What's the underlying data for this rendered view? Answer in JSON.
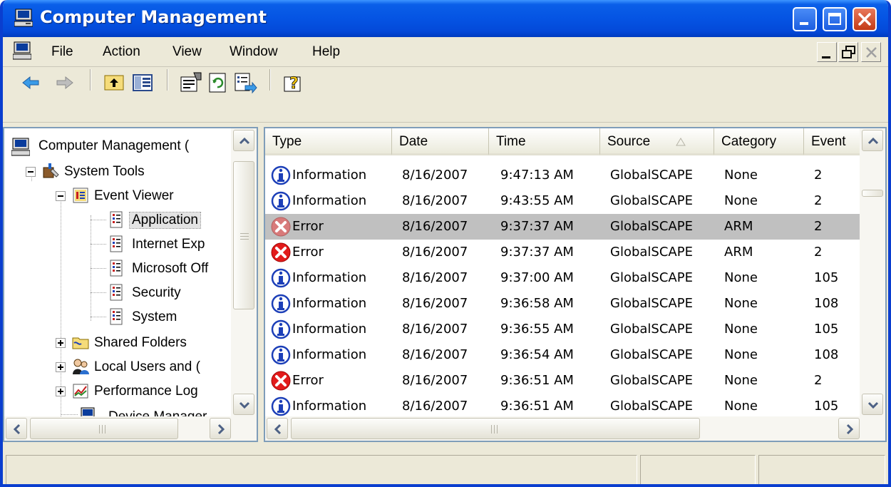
{
  "window": {
    "title": "Computer Management"
  },
  "menu": [
    {
      "label": "File"
    },
    {
      "label": "Action"
    },
    {
      "label": "View"
    },
    {
      "label": "Window"
    },
    {
      "label": "Help"
    }
  ],
  "toolbar": [
    {
      "icon": "back-arrow-icon"
    },
    {
      "icon": "forward-arrow-icon"
    },
    {
      "icon": "up-folder-icon"
    },
    {
      "icon": "show-hide-tree-icon"
    },
    {
      "icon": "properties-icon"
    },
    {
      "icon": "refresh-icon"
    },
    {
      "icon": "export-list-icon"
    },
    {
      "icon": "help-icon"
    }
  ],
  "tree": {
    "root": "Computer Management (",
    "items": [
      {
        "label": "System Tools"
      },
      {
        "label": "Event Viewer"
      },
      {
        "label": "Application"
      },
      {
        "label": "Internet Exp"
      },
      {
        "label": "Microsoft Off"
      },
      {
        "label": "Security"
      },
      {
        "label": "System"
      },
      {
        "label": "Shared Folders"
      },
      {
        "label": "Local Users and ("
      },
      {
        "label": "Performance Log"
      },
      {
        "label": "Device Manager"
      }
    ]
  },
  "list": {
    "columns": [
      "Type",
      "Date",
      "Time",
      "Source",
      "Category",
      "Event"
    ],
    "sort_column": "Source",
    "rows": [
      {
        "type": "Information",
        "date": "8/16/2007",
        "time": "9:47:13 AM",
        "source": "GlobalSCAPE",
        "category": "None",
        "event": "2"
      },
      {
        "type": "Information",
        "date": "8/16/2007",
        "time": "9:43:55 AM",
        "source": "GlobalSCAPE",
        "category": "None",
        "event": "2"
      },
      {
        "type": "Error",
        "date": "8/16/2007",
        "time": "9:37:37 AM",
        "source": "GlobalSCAPE",
        "category": "ARM",
        "event": "2",
        "selected": true
      },
      {
        "type": "Error",
        "date": "8/16/2007",
        "time": "9:37:37 AM",
        "source": "GlobalSCAPE",
        "category": "ARM",
        "event": "2"
      },
      {
        "type": "Information",
        "date": "8/16/2007",
        "time": "9:37:00 AM",
        "source": "GlobalSCAPE",
        "category": "None",
        "event": "105"
      },
      {
        "type": "Information",
        "date": "8/16/2007",
        "time": "9:36:58 AM",
        "source": "GlobalSCAPE",
        "category": "None",
        "event": "108"
      },
      {
        "type": "Information",
        "date": "8/16/2007",
        "time": "9:36:55 AM",
        "source": "GlobalSCAPE",
        "category": "None",
        "event": "105"
      },
      {
        "type": "Information",
        "date": "8/16/2007",
        "time": "9:36:54 AM",
        "source": "GlobalSCAPE",
        "category": "None",
        "event": "108"
      },
      {
        "type": "Error",
        "date": "8/16/2007",
        "time": "9:36:51 AM",
        "source": "GlobalSCAPE",
        "category": "None",
        "event": "2"
      },
      {
        "type": "Information",
        "date": "8/16/2007",
        "time": "9:36:51 AM",
        "source": "GlobalSCAPE",
        "category": "None",
        "event": "105"
      }
    ]
  },
  "colors": {
    "titlebar": "#0554e3",
    "chrome": "#ece9d8",
    "pane_border": "#7f9db9",
    "selected_row": "#c0c0c0",
    "error_red": "#e21b1b",
    "info_blue": "#1c3fb8"
  }
}
